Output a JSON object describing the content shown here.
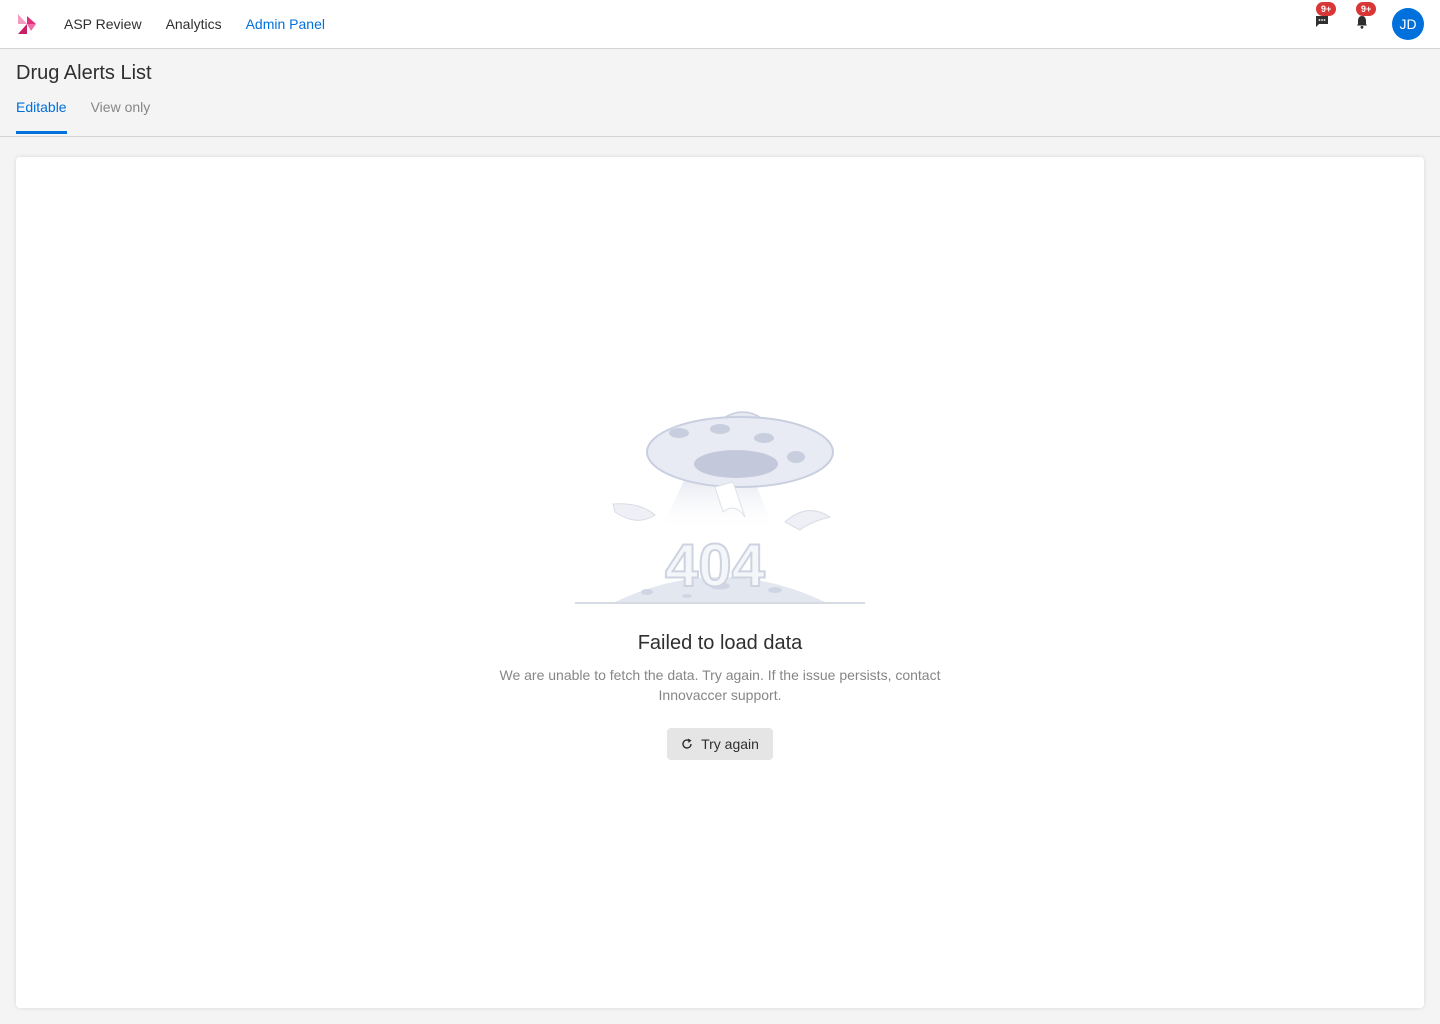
{
  "nav": {
    "links": [
      {
        "label": "ASP Review",
        "active": false
      },
      {
        "label": "Analytics",
        "active": false
      },
      {
        "label": "Admin Panel",
        "active": true
      }
    ],
    "chat_badge": "9+",
    "bell_badge": "9+",
    "avatar_initials": "JD"
  },
  "page": {
    "title": "Drug Alerts List",
    "tabs": [
      {
        "label": "Editable",
        "active": true
      },
      {
        "label": "View only",
        "active": false
      }
    ]
  },
  "error": {
    "code": "404",
    "title": "Failed to load data",
    "description": "We are unable to fetch the data. Try again. If the issue persists, contact Innovaccer support.",
    "retry_label": "Try again"
  },
  "colors": {
    "accent": "#0070dd",
    "badge": "#d93737",
    "logo_pink": "#e0307a"
  }
}
